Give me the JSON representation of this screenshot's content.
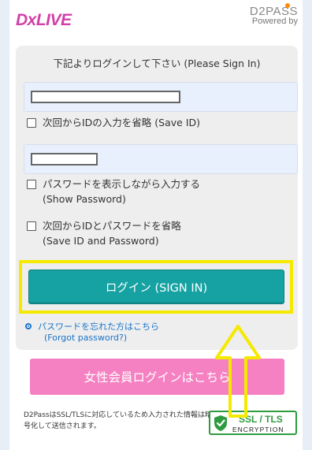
{
  "header": {
    "logo_text": "DxLIVE",
    "d2pass_mark": "D2PASS",
    "powered_by": "Powered by"
  },
  "login_panel": {
    "instruction": "下記よりログインして下さい (Please Sign In)",
    "save_id_label": "次回からIDの入力を省略 (Save ID)",
    "show_password_line1": "パスワードを表示しながら入力する",
    "show_password_line2": "(Show Password)",
    "save_both_line1": "次回からIDとパスワードを省略",
    "save_both_line2": "(Save ID and Password)",
    "login_button": "ログイン (SIGN IN)",
    "forgot_line1": "パスワードを忘れた方はこちら",
    "forgot_line2": "(Forgot password?)"
  },
  "women_login_button": "女性会員ログインはこちら",
  "footer": {
    "ssl_note": "D2PassはSSL/TLSに対応しているため入力された情報は暗号化して送信されます。",
    "ssl_badge_title": "SSL / TLS",
    "ssl_badge_sub": "ENCRYPTION"
  },
  "colors": {
    "brand": "#d23fa9",
    "login_button": "#16a2a2",
    "women_button": "#f580c2",
    "link": "#1a73c8",
    "highlight": "#f5e900",
    "ssl_green": "#2e9b40"
  }
}
